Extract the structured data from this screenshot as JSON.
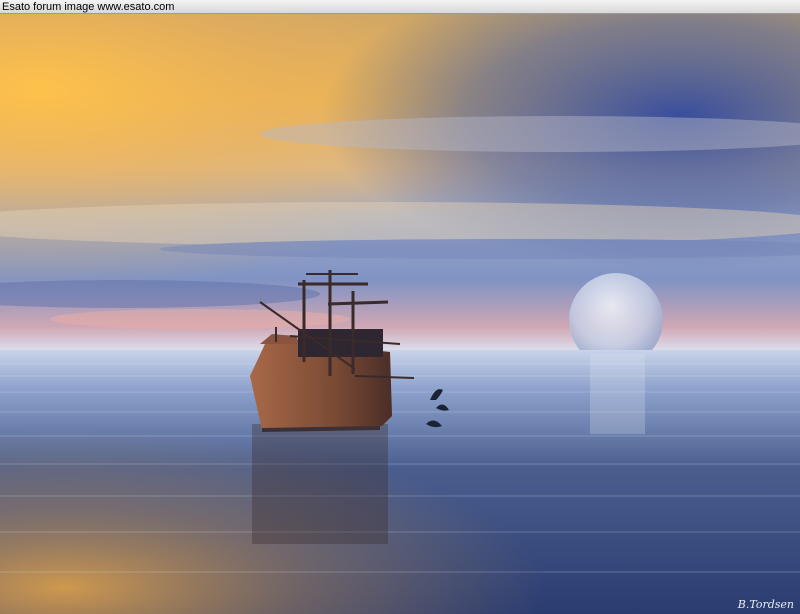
{
  "header": {
    "caption": "Esato forum image www.esato.com"
  },
  "scene": {
    "subjects": [
      "sailing-ship",
      "dolphins",
      "moon",
      "sea",
      "sunset-sky"
    ],
    "palette": {
      "sky_gold": "#f2b24a",
      "sky_blue": "#3f5aa2",
      "sea_dark": "#243668",
      "sea_light": "#b9c8e6"
    }
  },
  "signature": "B.Tordsen"
}
